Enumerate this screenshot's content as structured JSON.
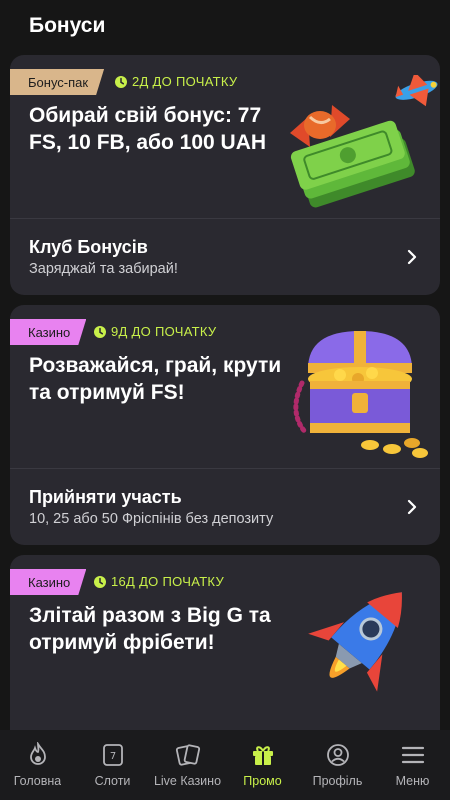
{
  "header": {
    "title": "Бонуси"
  },
  "cards": [
    {
      "tag": "Бонус-пак",
      "timer": "2Д ДО ПОЧАТКУ",
      "title": "Обирай свій бонус: 77 FS, 10 FB, або 100 UAH",
      "link_title": "Клуб Бонусів",
      "link_sub": "Заряджай та забирай!"
    },
    {
      "tag": "Казино",
      "timer": "9Д ДО ПОЧАТКУ",
      "title": "Розважайся, грай, крути та отримуй FS!",
      "link_title": "Прийняти участь",
      "link_sub": "10, 25 або 50 Фріспінів без депозиту"
    },
    {
      "tag": "Казино",
      "timer": "16Д ДО ПОЧАТКУ",
      "title": "Злітай разом з Big G та отримуй фрібети!"
    }
  ],
  "nav": [
    {
      "label": "Головна",
      "icon": "flame-icon"
    },
    {
      "label": "Слоти",
      "icon": "slot-machine-icon"
    },
    {
      "label": "Live Казино",
      "icon": "cards-icon"
    },
    {
      "label": "Промо",
      "icon": "gift-icon",
      "active": true
    },
    {
      "label": "Профіль",
      "icon": "profile-icon"
    },
    {
      "label": "Меню",
      "icon": "menu-icon"
    }
  ],
  "colors": {
    "accent": "#c8f04a",
    "card": "#2a2930",
    "background": "#161616",
    "tag_pak": "#d9b68b",
    "tag_casino": "#e882f0"
  }
}
